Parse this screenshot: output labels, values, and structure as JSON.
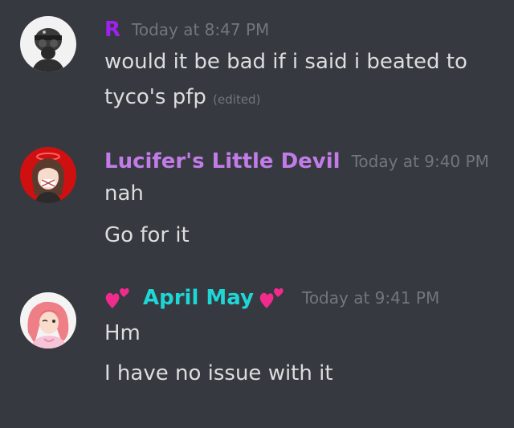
{
  "colors": {
    "background": "#36393f",
    "text": "#dcddde",
    "muted": "#72767d",
    "author_r": "#a020f0",
    "author_lucifer": "#c27ce8",
    "author_april": "#1fd6d6",
    "heart": "#f02b8c"
  },
  "messages": [
    {
      "author": "R",
      "timestamp": "Today at 8:47 PM",
      "lines": [
        "would it be bad if i said i beated to",
        "tyco's pfp"
      ],
      "edited": "(edited)",
      "avatar_icon": "gas-mask-helmet-avatar"
    },
    {
      "author": "Lucifer's Little Devil",
      "timestamp": "Today at 9:40 PM",
      "lines": [
        "nah",
        "Go for it"
      ],
      "avatar_icon": "anime-girl-red-avatar"
    },
    {
      "author": "April May",
      "timestamp": "Today at 9:41 PM",
      "lines": [
        "Hm",
        "I have no issue with it"
      ],
      "name_decoration": "two-hearts-emoji",
      "avatar_icon": "pink-hair-girl-avatar"
    }
  ]
}
